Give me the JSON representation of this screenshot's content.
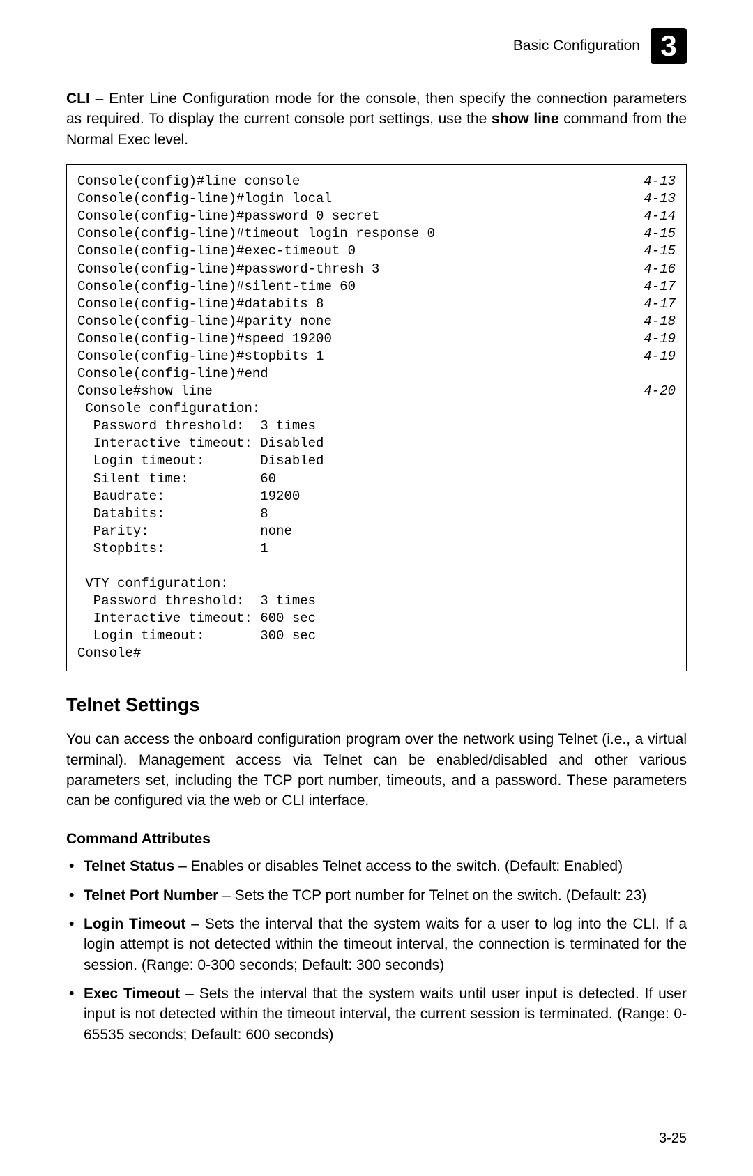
{
  "header": {
    "title": "Basic Configuration",
    "chapter": "3"
  },
  "intro": {
    "prefix": "CLI",
    "body1": " – Enter Line Configuration mode for the console, then specify the connection parameters as required. To display the current console port settings, use the ",
    "bold1": "show line",
    "body2": " command from the Normal Exec level."
  },
  "cli": [
    {
      "left": "Console(config)#line console",
      "ref": "4-13"
    },
    {
      "left": "Console(config-line)#login local",
      "ref": "4-13"
    },
    {
      "left": "Console(config-line)#password 0 secret",
      "ref": "4-14"
    },
    {
      "left": "Console(config-line)#timeout login response 0",
      "ref": "4-15"
    },
    {
      "left": "Console(config-line)#exec-timeout 0",
      "ref": "4-15"
    },
    {
      "left": "Console(config-line)#password-thresh 3",
      "ref": "4-16"
    },
    {
      "left": "Console(config-line)#silent-time 60",
      "ref": "4-17"
    },
    {
      "left": "Console(config-line)#databits 8",
      "ref": "4-17"
    },
    {
      "left": "Console(config-line)#parity none",
      "ref": "4-18"
    },
    {
      "left": "Console(config-line)#speed 19200",
      "ref": "4-19"
    },
    {
      "left": "Console(config-line)#stopbits 1",
      "ref": "4-19"
    },
    {
      "left": "Console(config-line)#end",
      "ref": ""
    },
    {
      "left": "Console#show line",
      "ref": "4-20"
    },
    {
      "left": " Console configuration:",
      "ref": ""
    },
    {
      "left": "  Password threshold:  3 times",
      "ref": ""
    },
    {
      "left": "  Interactive timeout: Disabled",
      "ref": ""
    },
    {
      "left": "  Login timeout:       Disabled",
      "ref": ""
    },
    {
      "left": "  Silent time:         60",
      "ref": ""
    },
    {
      "left": "  Baudrate:            19200",
      "ref": ""
    },
    {
      "left": "  Databits:            8",
      "ref": ""
    },
    {
      "left": "  Parity:              none",
      "ref": ""
    },
    {
      "left": "  Stopbits:            1",
      "ref": ""
    },
    {
      "left": "",
      "ref": ""
    },
    {
      "left": " VTY configuration:",
      "ref": ""
    },
    {
      "left": "  Password threshold:  3 times",
      "ref": ""
    },
    {
      "left": "  Interactive timeout: 600 sec",
      "ref": ""
    },
    {
      "left": "  Login timeout:       300 sec",
      "ref": ""
    },
    {
      "left": "Console#",
      "ref": ""
    }
  ],
  "section": {
    "heading": "Telnet Settings",
    "para": "You can access the onboard configuration program over the network using Telnet (i.e., a virtual terminal). Management access via Telnet can be enabled/disabled and other various parameters set, including the TCP port number, timeouts, and a password. These parameters can be configured via the web or CLI interface."
  },
  "commandAttributes": {
    "heading": "Command Attributes",
    "items": [
      {
        "term": "Telnet Status",
        "desc": " – Enables or disables Telnet access to the switch. (Default: Enabled)"
      },
      {
        "term": "Telnet Port Number",
        "desc": " – Sets the TCP port number for Telnet on the switch. (Default: 23)"
      },
      {
        "term": "Login Timeout",
        "desc": " – Sets the interval that the system waits for a user to log into the CLI. If a login attempt is not detected within the timeout interval, the connection is terminated for the session. (Range: 0-300 seconds; Default: 300 seconds)"
      },
      {
        "term": "Exec Timeout",
        "desc": " – Sets the interval that the system waits until user input is detected. If user input is not detected within the timeout interval, the current session is terminated. (Range: 0-65535 seconds; Default: 600 seconds)"
      }
    ]
  },
  "pageNumber": "3-25"
}
